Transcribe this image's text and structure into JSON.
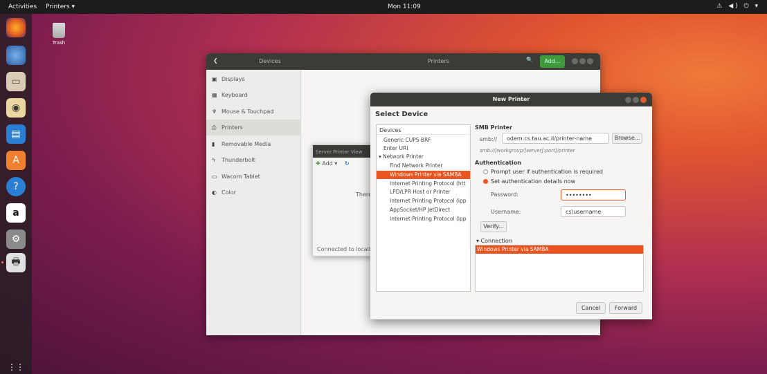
{
  "topbar": {
    "activities": "Activities",
    "app_menu": "Printers ▾",
    "clock": "Mon 11:09",
    "tray": "⚠ ◀) ⏻ ▾"
  },
  "desktop": {
    "trash_label": "Trash"
  },
  "settings": {
    "left_title": "Devices",
    "right_title": "Printers",
    "add_label": "Add...",
    "sidebar": [
      {
        "label": "Displays",
        "icon": "display-icon"
      },
      {
        "label": "Keyboard",
        "icon": "keyboard-icon"
      },
      {
        "label": "Mouse & Touchpad",
        "icon": "mouse-icon"
      },
      {
        "label": "Printers",
        "icon": "printer-icon"
      },
      {
        "label": "Removable Media",
        "icon": "usb-icon"
      },
      {
        "label": "Thunderbolt",
        "icon": "thunderbolt-icon"
      },
      {
        "label": "Wacom Tablet",
        "icon": "tablet-icon"
      },
      {
        "label": "Color",
        "icon": "color-icon"
      }
    ]
  },
  "print_config": {
    "menubar": "Server  Printer  View",
    "add_label": "Add",
    "there_text": "There",
    "status": "Connected to localh"
  },
  "dialog": {
    "title": "New Printer",
    "heading": "Select Device",
    "devices_header": "Devices",
    "devices": [
      "Generic CUPS-BRF",
      "Enter URI",
      "▾ Network Printer",
      "Find Network Printer",
      "Windows Printer via SAMBA",
      "Internet Printing Protocol (htt",
      "LPD/LPR Host or Printer",
      "Internet Printing Protocol (ipp",
      "AppSocket/HP JetDirect",
      "Internet Printing Protocol (ipp"
    ],
    "smb_title": "SMB Printer",
    "smb_prefix": "smb://",
    "smb_value": "odem.cs.tau.ac.il/printer-name",
    "browse_label": "Browse...",
    "smb_hint": "smb://[workgroup/]server[:port]/printer",
    "auth_title": "Authentication",
    "radio_prompt": "Prompt user if authentication is required",
    "radio_set": "Set authentication details now",
    "password_label": "Password:",
    "password_value": "••••••••",
    "username_label": "Username:",
    "username_value": "cs\\username",
    "verify_label": "Verify...",
    "connection_label": "▾ Connection",
    "connection_selected": "Windows Printer via SAMBA",
    "cancel_label": "Cancel",
    "forward_label": "Forward"
  },
  "colors": {
    "accent": "#e95420",
    "headerbar": "#3b3b37"
  }
}
